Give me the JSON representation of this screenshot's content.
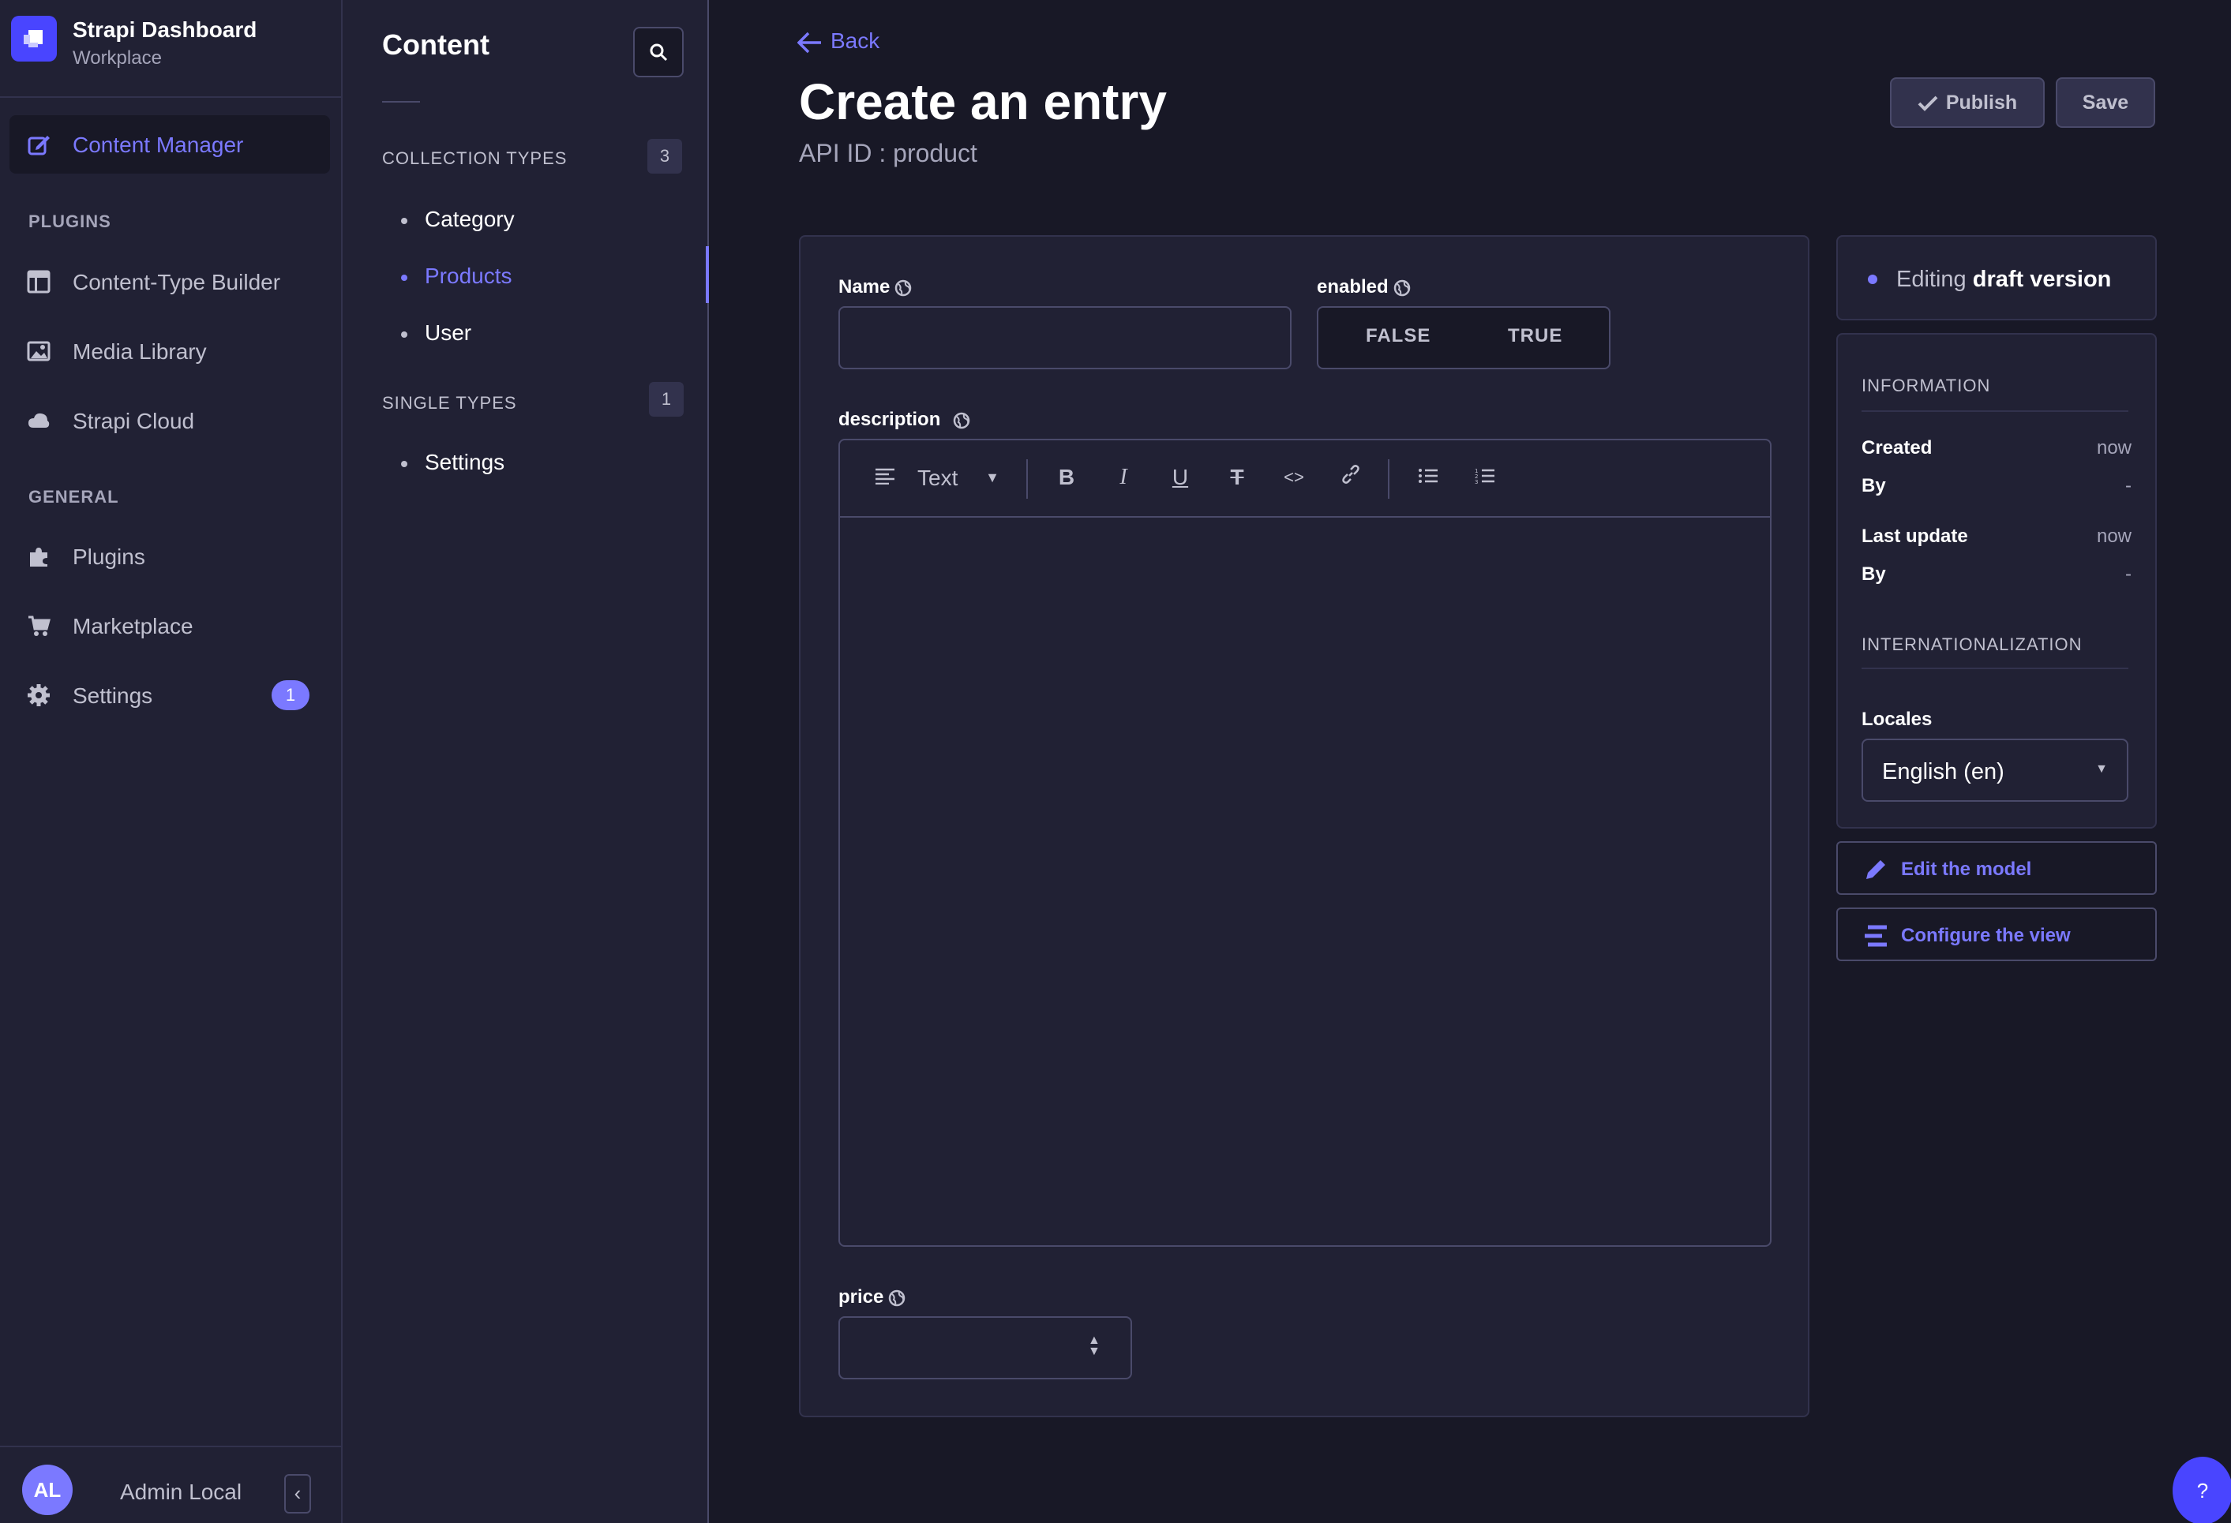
{
  "nav": {
    "brand_title": "Strapi Dashboard",
    "brand_sub": "Workplace",
    "active_item": "Content Manager",
    "plugins_label": "PLUGINS",
    "plugins": [
      "Content-Type Builder",
      "Media Library",
      "Strapi Cloud"
    ],
    "general_label": "GENERAL",
    "general": [
      "Plugins",
      "Marketplace",
      "Settings"
    ],
    "settings_badge": "1",
    "avatar_initials": "AL",
    "user_name": "Admin Local"
  },
  "content_nav": {
    "title": "Content",
    "collection_label": "COLLECTION TYPES",
    "collection_count": "3",
    "collection_items": [
      "Category",
      "Products",
      "User"
    ],
    "single_label": "SINGLE TYPES",
    "single_count": "1",
    "single_items": [
      "Settings"
    ]
  },
  "header": {
    "back": "Back",
    "title": "Create an entry",
    "api_id": "API ID : product",
    "publish": "Publish",
    "save": "Save"
  },
  "form": {
    "name_label": "Name",
    "name_value": "",
    "enabled_label": "enabled",
    "false_label": "FALSE",
    "true_label": "TRUE",
    "description_label": "description",
    "text_style": "Text",
    "price_label": "price",
    "price_value": ""
  },
  "sidebar": {
    "draft_prefix": "Editing ",
    "draft_bold": "draft version",
    "info_label": "INFORMATION",
    "created": "Created",
    "created_val": "now",
    "by1": "By",
    "by1_val": "-",
    "last_update": "Last update",
    "last_update_val": "now",
    "by2": "By",
    "by2_val": "-",
    "i18n_label": "INTERNATIONALIZATION",
    "locales_label": "Locales",
    "locale_value": "English (en)",
    "edit_model": "Edit the model",
    "configure_view": "Configure the view"
  },
  "help": "?",
  "colors": {
    "background": "#181826",
    "surface": "#212134",
    "accent": "#7b79ff",
    "primary": "#4945ff"
  }
}
